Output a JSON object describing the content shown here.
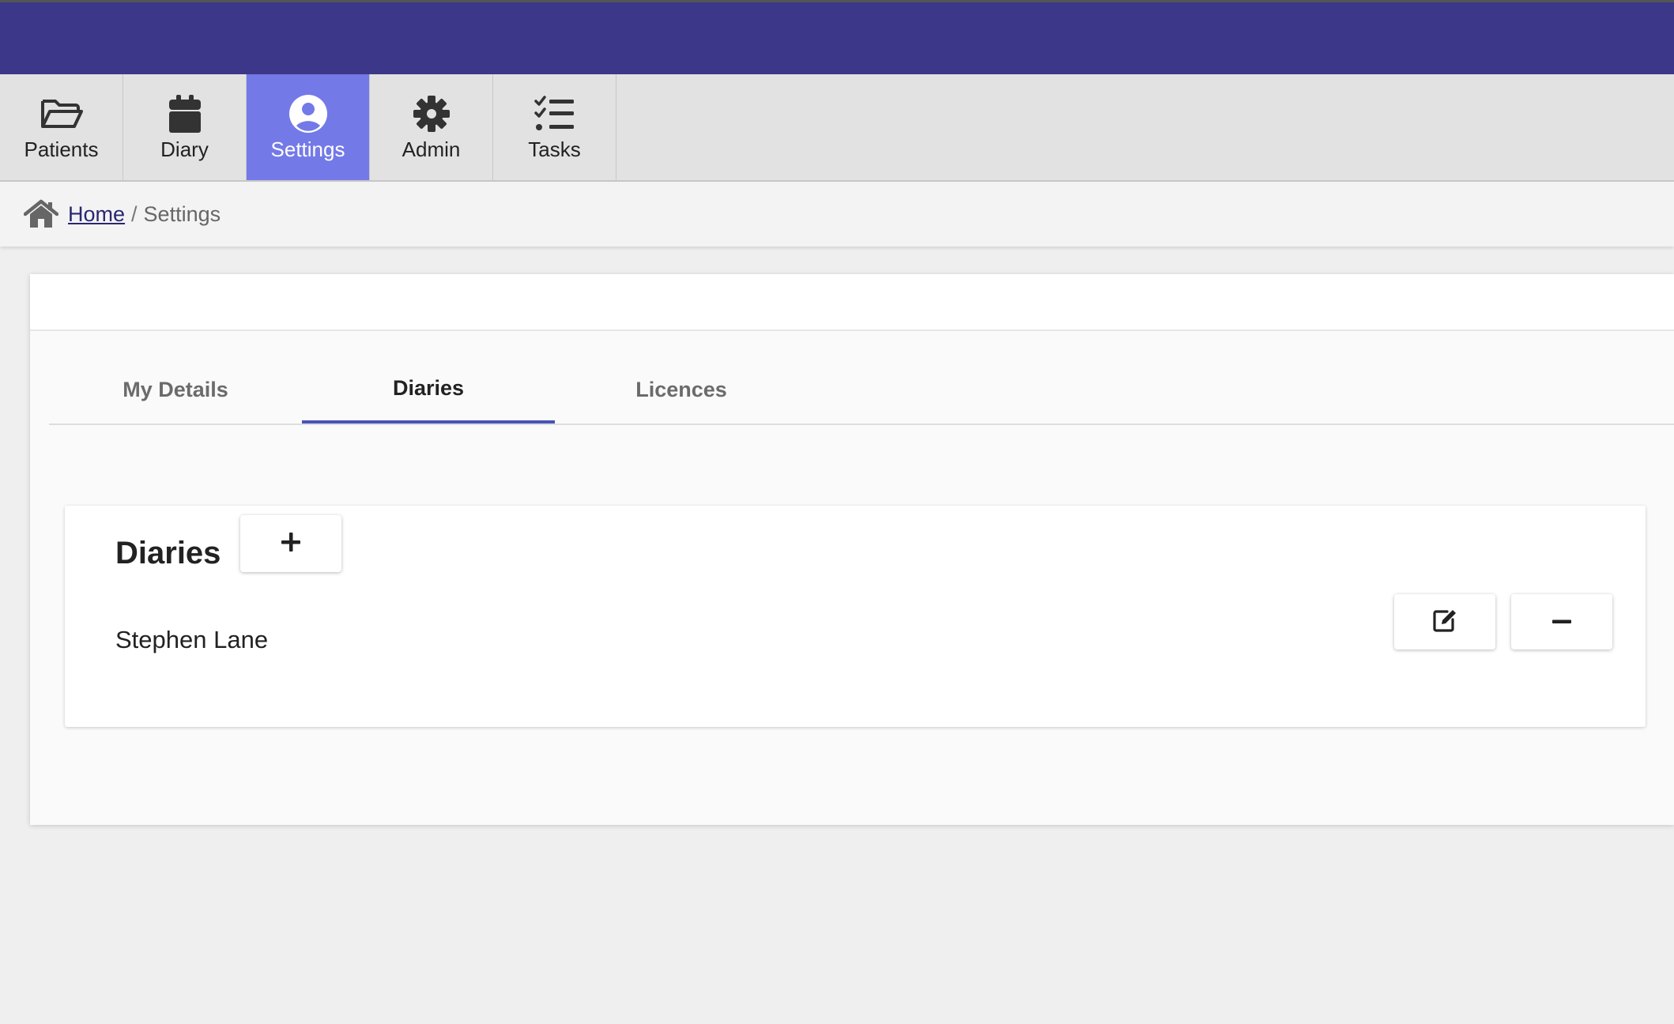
{
  "nav": {
    "items": [
      {
        "label": "Patients",
        "icon": "folder-open-icon",
        "active": false
      },
      {
        "label": "Diary",
        "icon": "calendar-icon",
        "active": false
      },
      {
        "label": "Settings",
        "icon": "user-circle-icon",
        "active": true
      },
      {
        "label": "Admin",
        "icon": "gear-icon",
        "active": false
      },
      {
        "label": "Tasks",
        "icon": "task-list-icon",
        "active": false
      }
    ]
  },
  "breadcrumb": {
    "home": "Home",
    "separator": "/",
    "current": "Settings"
  },
  "tabs": [
    {
      "label": "My Details",
      "active": false
    },
    {
      "label": "Diaries",
      "active": true
    },
    {
      "label": "Licences",
      "active": false
    }
  ],
  "diaries": {
    "title": "Diaries",
    "add_icon": "plus-icon",
    "items": [
      {
        "name": "Stephen Lane",
        "edit_icon": "edit-icon",
        "remove_icon": "minus-icon"
      }
    ]
  },
  "colors": {
    "topbar": "#3c3789",
    "nav_active": "#7479e8",
    "tab_underline": "#4a52b8",
    "link": "#2a2670"
  }
}
